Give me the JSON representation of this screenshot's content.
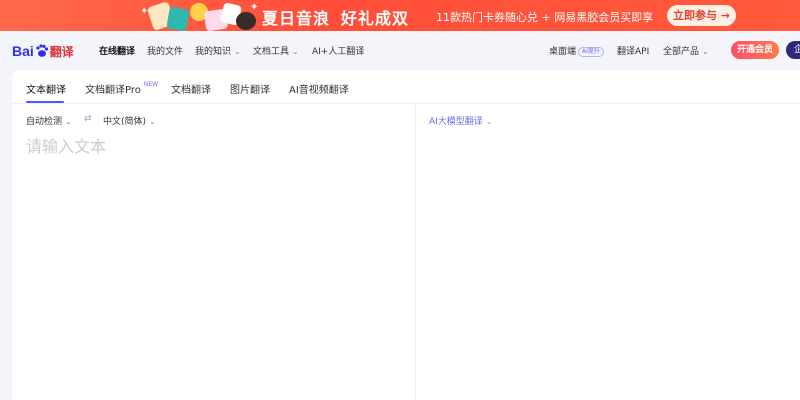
{
  "banner": {
    "title1": "夏日音浪",
    "title2": "好礼成双",
    "subtitle": "11款热门卡券随心兑 + 网易黑胶会员买即享",
    "cta": "立即参与 →"
  },
  "header": {
    "logo_text": "Bai",
    "logo_suffix": "翻译",
    "nav": [
      {
        "label": "在线翻译"
      },
      {
        "label": "我的文件"
      },
      {
        "label": "我的知识"
      },
      {
        "label": "文档工具"
      },
      {
        "label": "AI+人工翻译"
      }
    ],
    "right": {
      "desktop": "桌面端",
      "desktop_badge": "AI提升",
      "api": "翻译API",
      "products": "全部产品",
      "vip_button": "开通会员",
      "user_button": "企"
    }
  },
  "tabs": [
    {
      "label": "文本翻译"
    },
    {
      "label": "文档翻译Pro",
      "badge": "NEW"
    },
    {
      "label": "文档翻译"
    },
    {
      "label": "图片翻译"
    },
    {
      "label": "AI音视频翻译"
    }
  ],
  "source_lang": "自动检测",
  "swap_symbol": "⇄",
  "target_lang": "中文(简体)",
  "ai_model": "AI大模型翻译",
  "input": {
    "value": "",
    "placeholder": "请输入文本"
  },
  "colors": {
    "accent": "#4c5bff",
    "banner": "#ff4e3a",
    "vip": "#ff4f6b"
  }
}
